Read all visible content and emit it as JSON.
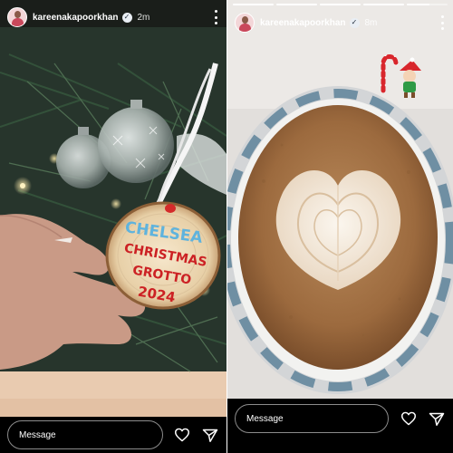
{
  "stories": [
    {
      "username": "kareenakapoorkhan",
      "timestamp": "2m",
      "ornament_lines": [
        "CHELSEA",
        "CHRISTMAS",
        "GROTTO",
        "2024"
      ],
      "message_placeholder": "Message"
    },
    {
      "username": "kareenakapoorkhan",
      "timestamp": "8m",
      "progress": [
        1,
        1,
        1,
        1,
        0.55
      ],
      "message_placeholder": "Message"
    }
  ],
  "icons": {
    "verified": "verified-badge-icon",
    "more": "more-options-icon",
    "like": "heart-icon",
    "share": "send-icon"
  }
}
